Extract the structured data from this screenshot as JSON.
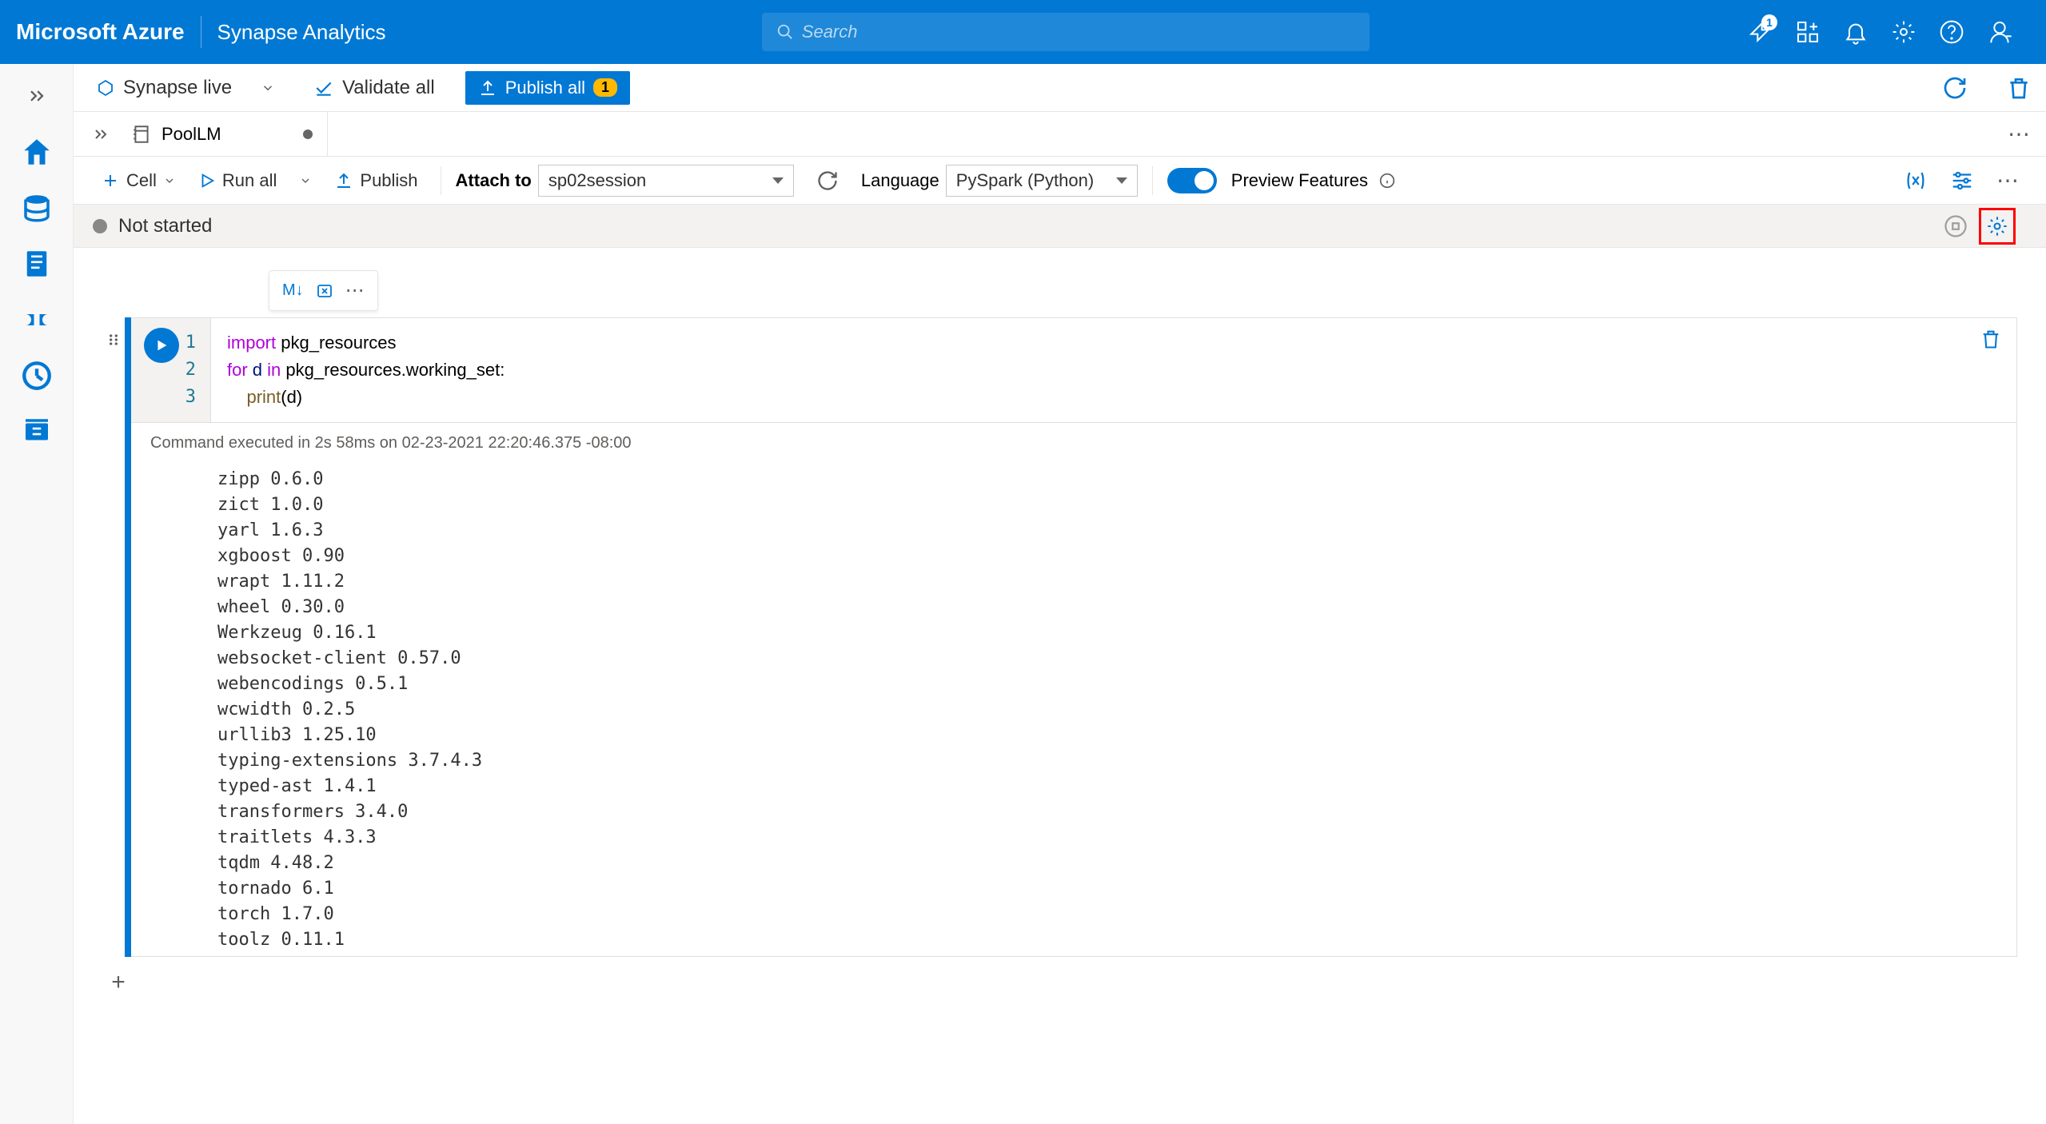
{
  "brand": "Microsoft Azure",
  "product": "Synapse Analytics",
  "search": {
    "placeholder": "Search"
  },
  "notifications_badge": "1",
  "toolbar": {
    "mode": "Synapse live",
    "validate": "Validate all",
    "publish": "Publish all",
    "publish_count": "1"
  },
  "tab": {
    "name": "PoolLM"
  },
  "nb_toolbar": {
    "cell": "Cell",
    "run": "Run all",
    "publish": "Publish",
    "attach": "Attach to",
    "attach_val": "sp02session",
    "language": "Language",
    "language_val": "PySpark (Python)",
    "preview": "Preview Features"
  },
  "status": "Not started",
  "cell_toolbar": {
    "md": "M↓"
  },
  "code": {
    "line1_kw": "import",
    "line1_rest": " pkg_resources",
    "line2_kw1": "for",
    "line2_id": " d ",
    "line2_kw2": "in",
    "line2_rest": " pkg_resources.working_set:",
    "line3_indent": "    ",
    "line3_fn": "print",
    "line3_rest": "(d)"
  },
  "output_meta": "Command executed in 2s 58ms on 02-23-2021 22:20:46.375 -08:00",
  "output": "zipp 0.6.0\nzict 1.0.0\nyarl 1.6.3\nxgboost 0.90\nwrapt 1.11.2\nwheel 0.30.0\nWerkzeug 0.16.1\nwebsocket-client 0.57.0\nwebencodings 0.5.1\nwcwidth 0.2.5\nurllib3 1.25.10\ntyping-extensions 3.7.4.3\ntyped-ast 1.4.1\ntransformers 3.4.0\ntraitlets 4.3.3\ntqdm 4.48.2\ntornado 6.1\ntorch 1.7.0\ntoolz 0.11.1"
}
